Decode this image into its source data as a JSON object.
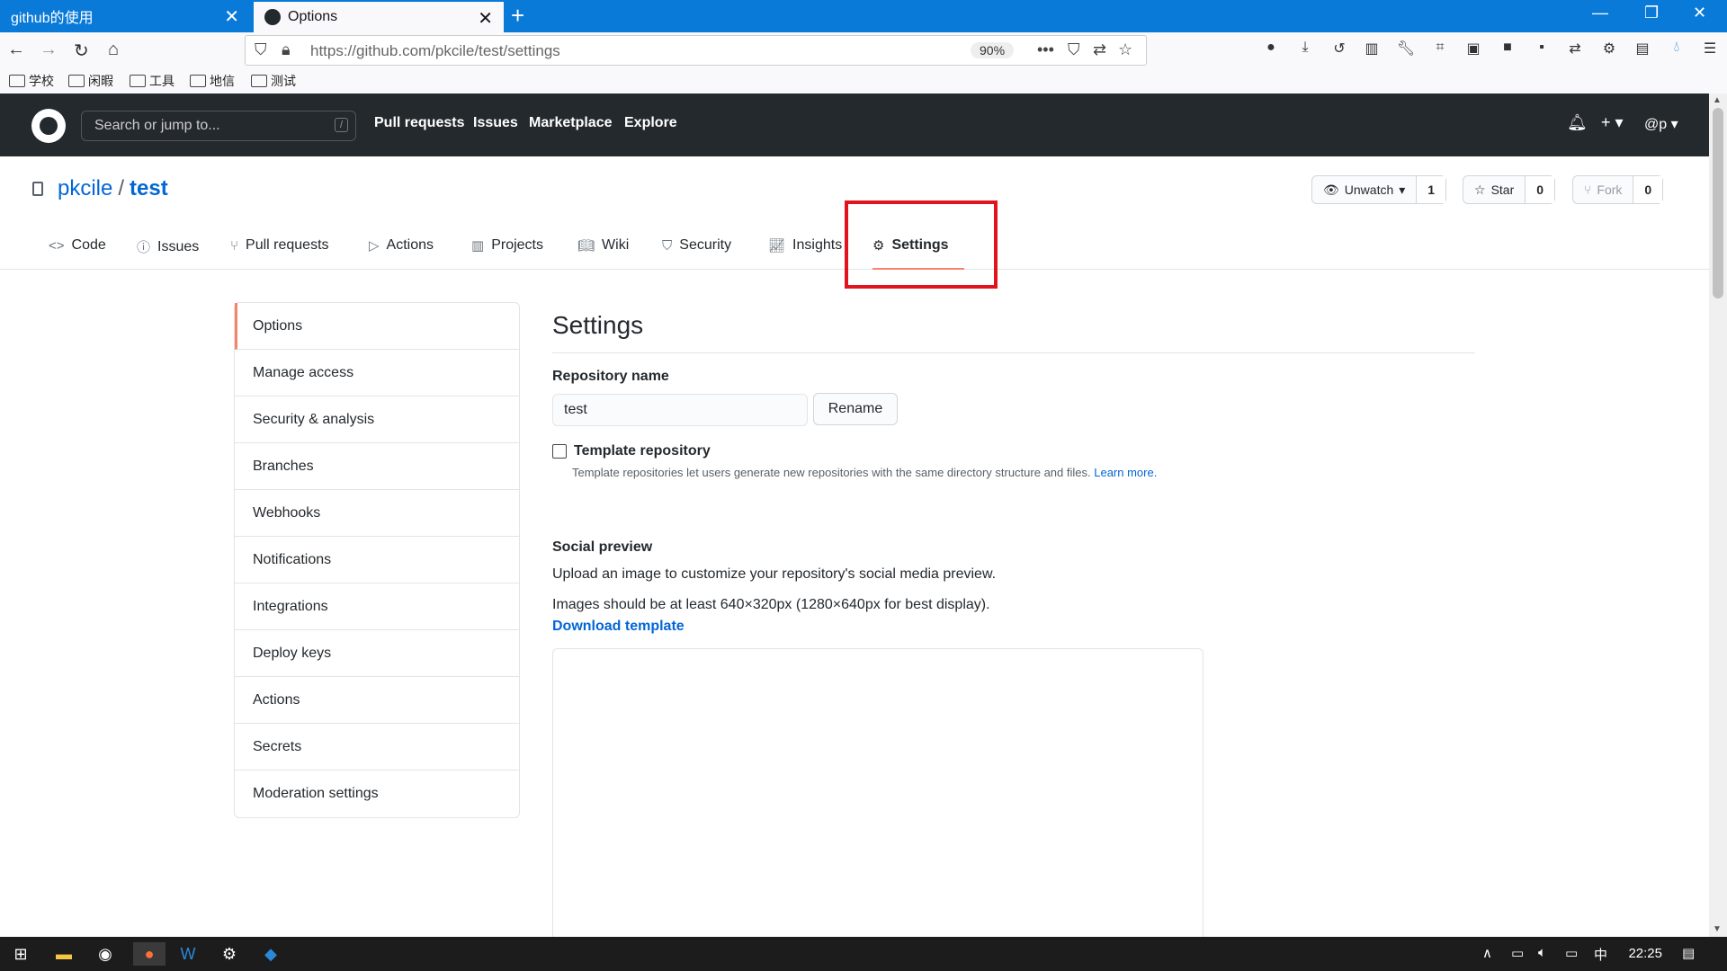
{
  "browser": {
    "tabs": [
      {
        "title": "github的使用"
      },
      {
        "title": "Options"
      }
    ],
    "url": "https://github.com/pkcile/test/settings",
    "zoom": "90%",
    "bookmarks": [
      "学校",
      "闲暇",
      "工具",
      "地信",
      "测试"
    ]
  },
  "gh_header": {
    "search_placeholder": "Search or jump to...",
    "search_key": "/",
    "nav": [
      "Pull requests",
      "Issues",
      "Marketplace",
      "Explore"
    ],
    "user": "@p"
  },
  "repo": {
    "owner": "pkcile",
    "separator": "/",
    "name": "test",
    "watch_label": "Unwatch",
    "watch_count": "1",
    "star_label": "Star",
    "star_count": "0",
    "fork_label": "Fork",
    "fork_count": "0",
    "tabs": [
      "Code",
      "Issues",
      "Pull requests",
      "Actions",
      "Projects",
      "Wiki",
      "Security",
      "Insights",
      "Settings"
    ]
  },
  "sidebar": {
    "items": [
      "Options",
      "Manage access",
      "Security & analysis",
      "Branches",
      "Webhooks",
      "Notifications",
      "Integrations",
      "Deploy keys",
      "Actions",
      "Secrets",
      "Moderation settings"
    ]
  },
  "settings": {
    "heading": "Settings",
    "repo_name_label": "Repository name",
    "repo_name_value": "test",
    "rename_label": "Rename",
    "template_label": "Template repository",
    "template_desc": "Template repositories let users generate new repositories with the same directory structure and files.",
    "learn_more": "Learn more.",
    "social_heading": "Social preview",
    "social_desc": "Upload an image to customize your repository's social media preview.",
    "social_size": "Images should be at least 640×320px (1280×640px for best display).",
    "download_template": "Download template"
  },
  "taskbar": {
    "clock": "22:25",
    "ime": "中"
  },
  "colors": {
    "tab_bar": "#0a7ad8",
    "gh_header": "#24292e",
    "link": "#0366d6",
    "active_underline": "#f9826c",
    "highlight_box": "#e0141e"
  }
}
